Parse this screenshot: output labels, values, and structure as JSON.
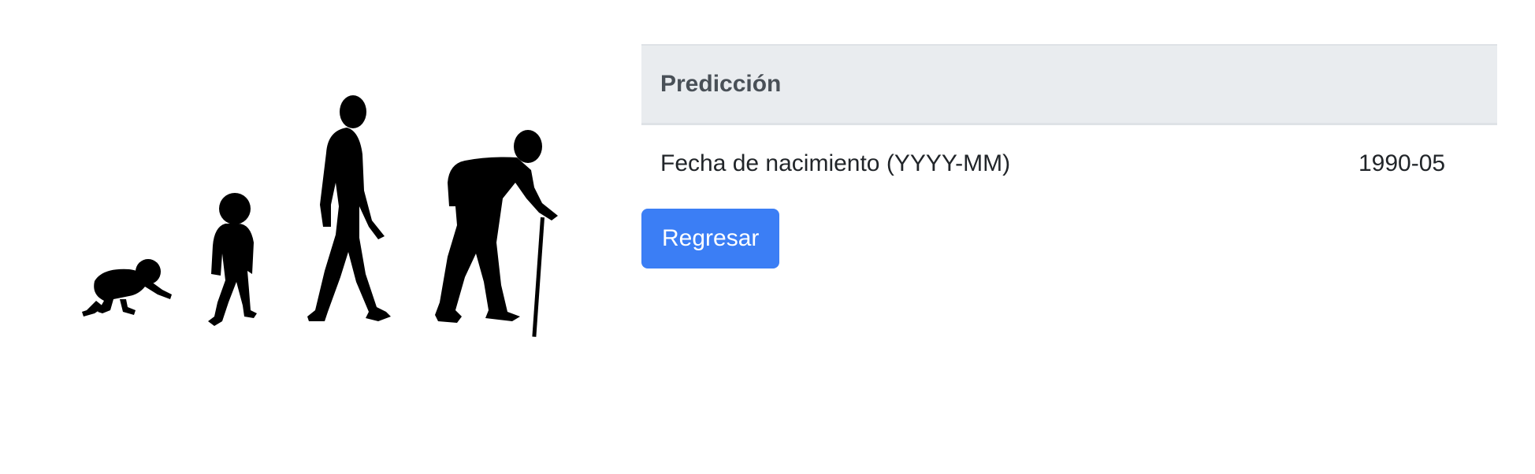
{
  "illustration": {
    "alt": "crawling-baby, toddler, walking-adult, elderly-with-cane",
    "color": "#000000"
  },
  "prediction_table": {
    "header": "Predicción",
    "rows": [
      {
        "label": "Fecha de nacimiento (YYYY-MM)",
        "value": "1990-05"
      }
    ]
  },
  "actions": {
    "back_label": "Regresar",
    "button_color": "#3b7ef5"
  }
}
